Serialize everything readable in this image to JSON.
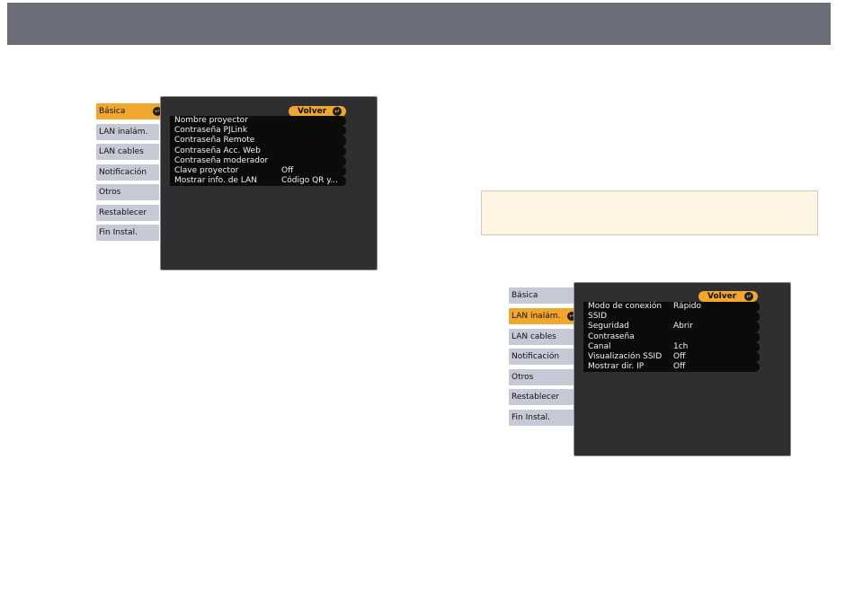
{
  "panel1": {
    "tabs": [
      {
        "label": "Básica",
        "active": true
      },
      {
        "label": "LAN inalám.",
        "active": false
      },
      {
        "label": "LAN cables",
        "active": false
      },
      {
        "label": "Notificación",
        "active": false
      },
      {
        "label": "Otros",
        "active": false
      },
      {
        "label": "Restablecer",
        "active": false
      },
      {
        "label": "Fin Instal.",
        "active": false
      }
    ],
    "back_label": "Volver",
    "rows": [
      {
        "label": "Nombre proyector",
        "value": ""
      },
      {
        "label": "Contraseña PJLink",
        "value": ""
      },
      {
        "label": "Contraseña Remote",
        "value": ""
      },
      {
        "label": "Contraseña Acc. Web",
        "value": ""
      },
      {
        "label": "Contraseña moderador",
        "value": ""
      },
      {
        "label": "Clave proyector",
        "value": "Off"
      },
      {
        "label": "Mostrar info. de LAN",
        "value": "Código QR y..."
      }
    ]
  },
  "panel2": {
    "tabs": [
      {
        "label": "Básica",
        "active": false
      },
      {
        "label": "LAN inalám.",
        "active": true
      },
      {
        "label": "LAN cables",
        "active": false
      },
      {
        "label": "Notificación",
        "active": false
      },
      {
        "label": "Otros",
        "active": false
      },
      {
        "label": "Restablecer",
        "active": false
      },
      {
        "label": "Fin Instal.",
        "active": false
      }
    ],
    "back_label": "Volver",
    "rows": [
      {
        "label": "Modo de conexión",
        "value": "Rápido"
      },
      {
        "label": "SSID",
        "value": ""
      },
      {
        "label": "Seguridad",
        "value": "Abrir"
      },
      {
        "label": "Contraseña",
        "value": ""
      },
      {
        "label": "Canal",
        "value": "1ch"
      },
      {
        "label": "Visualización SSID",
        "value": "Off"
      },
      {
        "label": "Mostrar dir. IP",
        "value": "Off"
      }
    ]
  },
  "colors": {
    "header_bar": "#6b6e79",
    "active_tab": "#f1a62e",
    "inactive_tab": "#c7c9d6",
    "menu_bg": "#2f2f31",
    "note_bg": "#fdf4e3"
  }
}
